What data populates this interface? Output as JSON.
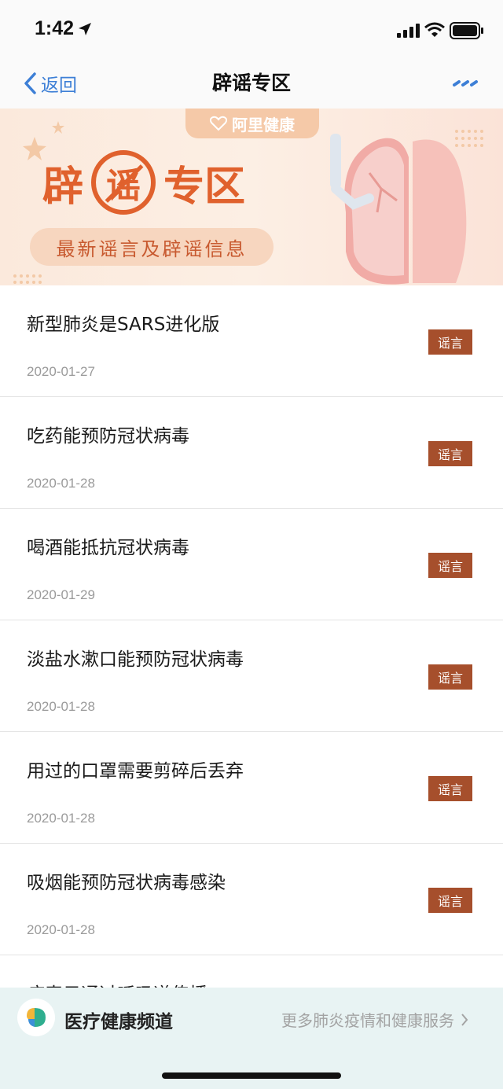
{
  "status": {
    "time": "1:42"
  },
  "nav": {
    "back_label": "返回",
    "title": "辟谣专区"
  },
  "banner": {
    "brand": "阿里健康",
    "title_chars": [
      "辟",
      "谣",
      "专区"
    ],
    "subtitle": "最新谣言及辟谣信息"
  },
  "list": [
    {
      "title": "新型肺炎是SARS进化版",
      "date": "2020-01-27",
      "badge": "谣言"
    },
    {
      "title": "吃药能预防冠状病毒",
      "date": "2020-01-28",
      "badge": "谣言"
    },
    {
      "title": "喝酒能抵抗冠状病毒",
      "date": "2020-01-29",
      "badge": "谣言"
    },
    {
      "title": "淡盐水漱口能预防冠状病毒",
      "date": "2020-01-28",
      "badge": "谣言"
    },
    {
      "title": "用过的口罩需要剪碎后丢弃",
      "date": "2020-01-28",
      "badge": "谣言"
    },
    {
      "title": "吸烟能预防冠状病毒感染",
      "date": "2020-01-28",
      "badge": "谣言"
    },
    {
      "title": "病毒只通过呼吸道传播",
      "date": "",
      "badge": ""
    }
  ],
  "bottom_bar": {
    "title": "医疗健康频道",
    "link_label": "更多肺炎疫情和健康服务"
  },
  "colors": {
    "accent_blue": "#3d7fd6",
    "banner_orange": "#e0612d",
    "badge_brown": "#a64f2c",
    "bottom_bg": "#e8f3f3"
  },
  "icons": [
    "location-arrow-icon",
    "signal-icon",
    "wifi-icon",
    "battery-icon",
    "chevron-left-icon",
    "more-dots-icon",
    "brand-heart-icon",
    "health-channel-logo-icon",
    "chevron-right-icon"
  ]
}
